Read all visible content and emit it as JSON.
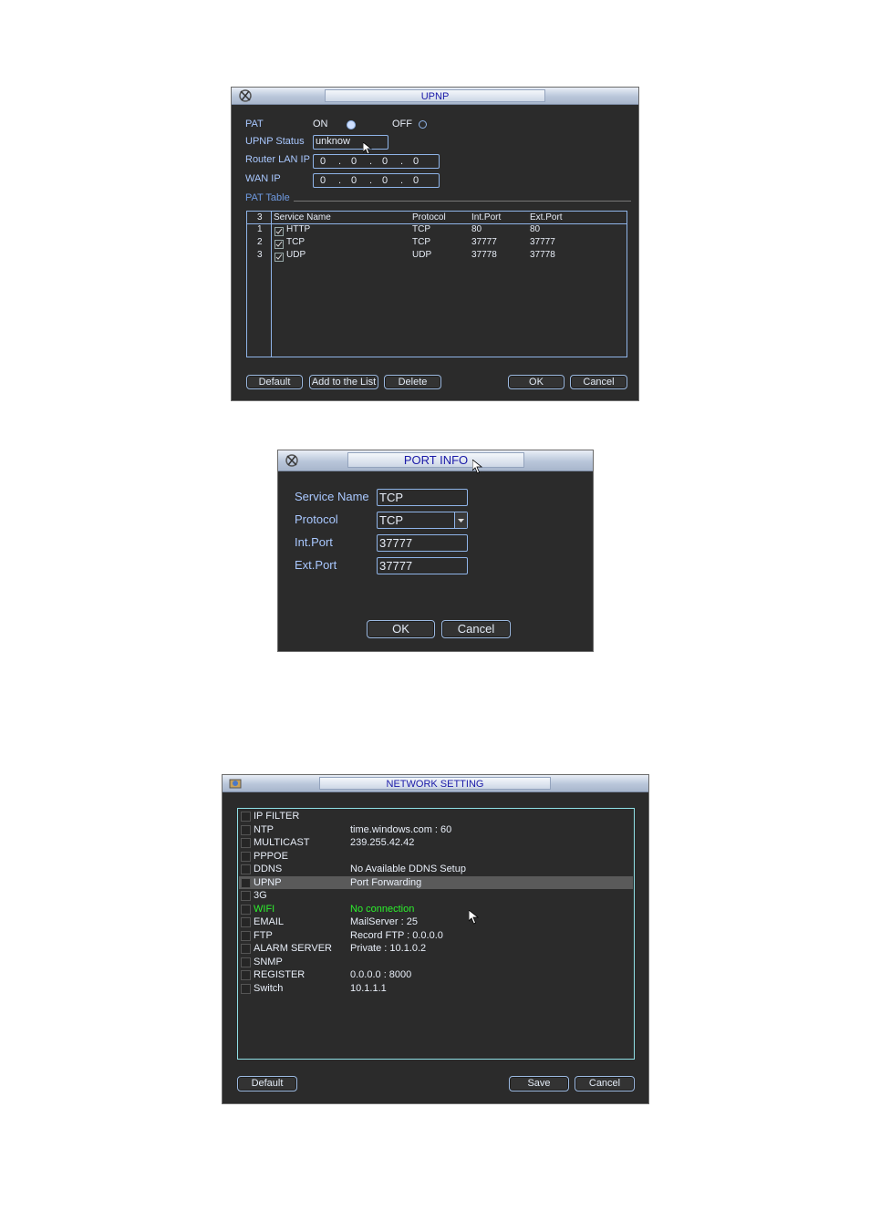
{
  "upnp": {
    "title": "UPNP",
    "pat_label": "PAT",
    "on_label": "ON",
    "off_label": "OFF",
    "status_label": "UPNP Status",
    "status_value": "unknow",
    "router_ip_label": "Router LAN IP",
    "router_ip": [
      "0",
      "0",
      "0",
      "0"
    ],
    "wan_ip_label": "WAN IP",
    "wan_ip": [
      "0",
      "0",
      "0",
      "0"
    ],
    "pat_table_label": "PAT Table",
    "table": {
      "count": "3",
      "headers": [
        "Service Name",
        "Protocol",
        "Int.Port",
        "Ext.Port"
      ],
      "rows": [
        {
          "idx": "1",
          "name": "HTTP",
          "protocol": "TCP",
          "int_port": "80",
          "ext_port": "80"
        },
        {
          "idx": "2",
          "name": "TCP",
          "protocol": "TCP",
          "int_port": "37777",
          "ext_port": "37777"
        },
        {
          "idx": "3",
          "name": "UDP",
          "protocol": "UDP",
          "int_port": "37778",
          "ext_port": "37778"
        }
      ]
    },
    "buttons": {
      "default": "Default",
      "add": "Add to the List",
      "delete": "Delete",
      "ok": "OK",
      "cancel": "Cancel"
    }
  },
  "port_info": {
    "title": "PORT INFO",
    "service_name_label": "Service Name",
    "service_name_value": "TCP",
    "protocol_label": "Protocol",
    "protocol_value": "TCP",
    "int_port_label": "Int.Port",
    "int_port_value": "37777",
    "ext_port_label": "Ext.Port",
    "ext_port_value": "37777",
    "buttons": {
      "ok": "OK",
      "cancel": "Cancel"
    }
  },
  "network": {
    "title": "NETWORK SETTING",
    "items": [
      {
        "name": "IP FILTER",
        "value": ""
      },
      {
        "name": "NTP",
        "value": "time.windows.com : 60"
      },
      {
        "name": "MULTICAST",
        "value": "239.255.42.42"
      },
      {
        "name": "PPPOE",
        "value": ""
      },
      {
        "name": "DDNS",
        "value": "No Available DDNS Setup"
      },
      {
        "name": "UPNP",
        "value": "Port Forwarding"
      },
      {
        "name": "3G",
        "value": ""
      },
      {
        "name": "WIFI",
        "value": "No connection"
      },
      {
        "name": "EMAIL",
        "value": "MailServer : 25"
      },
      {
        "name": "FTP",
        "value": "Record FTP : 0.0.0.0"
      },
      {
        "name": "ALARM SERVER",
        "value": "Private : 10.1.0.2"
      },
      {
        "name": "SNMP",
        "value": ""
      },
      {
        "name": "REGISTER",
        "value": "0.0.0.0 : 8000"
      },
      {
        "name": "Switch",
        "value": "10.1.1.1"
      }
    ],
    "selected_item": "UPNP",
    "highlight_item": "WIFI",
    "buttons": {
      "default": "Default",
      "save": "Save",
      "cancel": "Cancel"
    }
  },
  "colors": {
    "label": "#a9c8ff",
    "border": "#8fb4e8",
    "wifi": "#2cf02c",
    "selection": "#5a5a5a",
    "title_text": "#1a1aa8"
  }
}
